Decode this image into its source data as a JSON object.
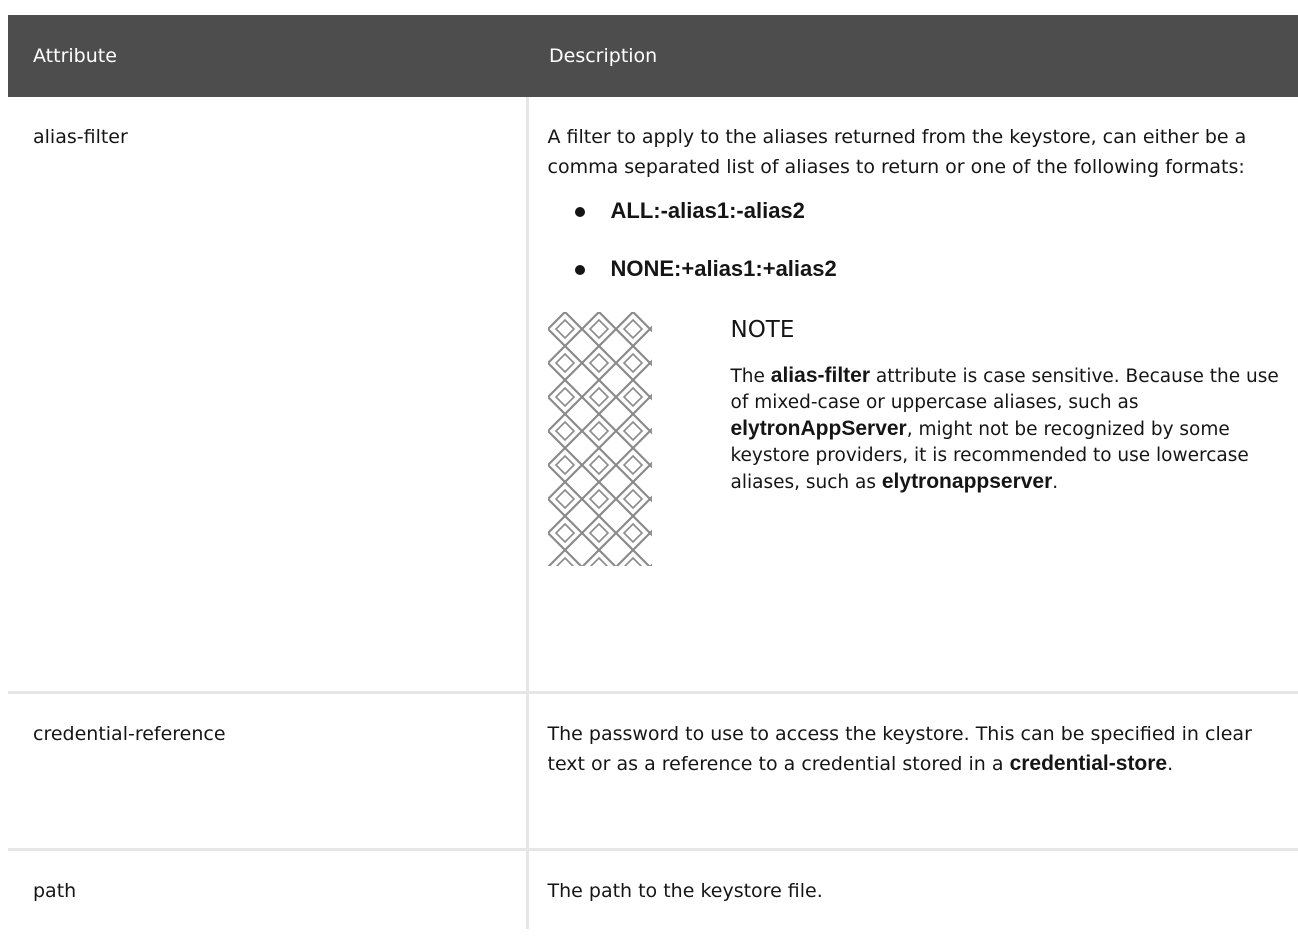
{
  "table": {
    "headers": {
      "attribute": "Attribute",
      "description": "Description"
    },
    "rows": [
      {
        "attribute": "alias-filter",
        "description": "A filter to apply to the aliases returned from the keystore, can either be a comma separated list of aliases to return or one of the following formats:",
        "bullets": [
          "ALL:-alias1:-alias2",
          "NONE:+alias1:+alias2"
        ],
        "note": {
          "title": "NOTE",
          "text_1": "The ",
          "strong_1": "alias-filter",
          "text_2": " attribute is case sensitive. Because the use of mixed-case or uppercase aliases, such as ",
          "strong_2": "elytronAppServer",
          "text_3": ", might not be recognized by some keystore providers, it is recommended to use lowercase aliases, such as ",
          "strong_3": "elytronappserver",
          "text_4": "."
        }
      },
      {
        "attribute": "credential-reference",
        "description": "The password to use to access the keystore. This can be specified in clear text or as a reference to a credential stored in a ",
        "strong": "credential-store",
        "description_end": "."
      },
      {
        "attribute": "path",
        "description": "The path to the keystore file."
      }
    ]
  },
  "colors": {
    "header_bg": "#4d4d4d",
    "header_text": "#ffffff",
    "border": "#e6e6e6",
    "text": "#151515"
  },
  "icons": {
    "note": "note-lattice-icon"
  }
}
